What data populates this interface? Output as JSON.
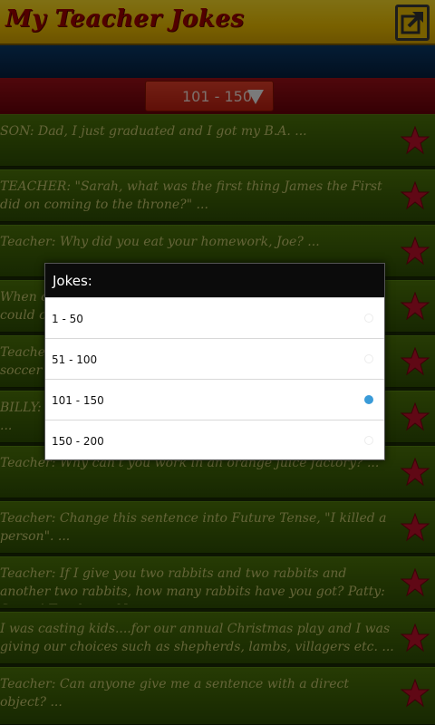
{
  "header": {
    "title": "My Teacher Jokes",
    "share_icon": "share-external-icon"
  },
  "filter": {
    "selected_range": "101 - 150"
  },
  "jokes": [
    {
      "text": "SON: Dad, I just graduated and I got my B.A. ..."
    },
    {
      "text": "TEACHER: \"Sarah, what was the first thing James the First did on coming to the throne?\" ..."
    },
    {
      "text": "Teacher: Why did you eat your homework, Joe? ..."
    },
    {
      "text": "When o could co"
    },
    {
      "text": "Teacher soccer m"
    },
    {
      "text": "BILLY: ..."
    },
    {
      "text": "Teacher: Why can't you work in an orange juice factory? ..."
    },
    {
      "text": "Teacher: Change this sentence into Future Tense, \"I killed a person\". ..."
    },
    {
      "text": "Teacher: If I give you two rabbits and two rabbits and another two rabbits, how many rabbits have you got? Patty: Seven! Teacher:...N"
    },
    {
      "text": "I was casting kids....for our annual Christmas play and I was giving our choices such as shepherds, lambs, villagers etc. ..."
    },
    {
      "text": "Teacher: Can anyone give me a sentence with a direct object? ..."
    }
  ],
  "dialog": {
    "title": "Jokes:",
    "options": [
      {
        "label": "1 - 50",
        "selected": false
      },
      {
        "label": "51 - 100",
        "selected": false
      },
      {
        "label": "101 - 150",
        "selected": true
      },
      {
        "label": "150 - 200",
        "selected": false
      }
    ]
  },
  "colors": {
    "header_yellow": "#f2c200",
    "title_red": "#a50000",
    "row_green": "#3e6206",
    "star_red": "#c0102a",
    "radio_blue": "#3a9bd8"
  }
}
